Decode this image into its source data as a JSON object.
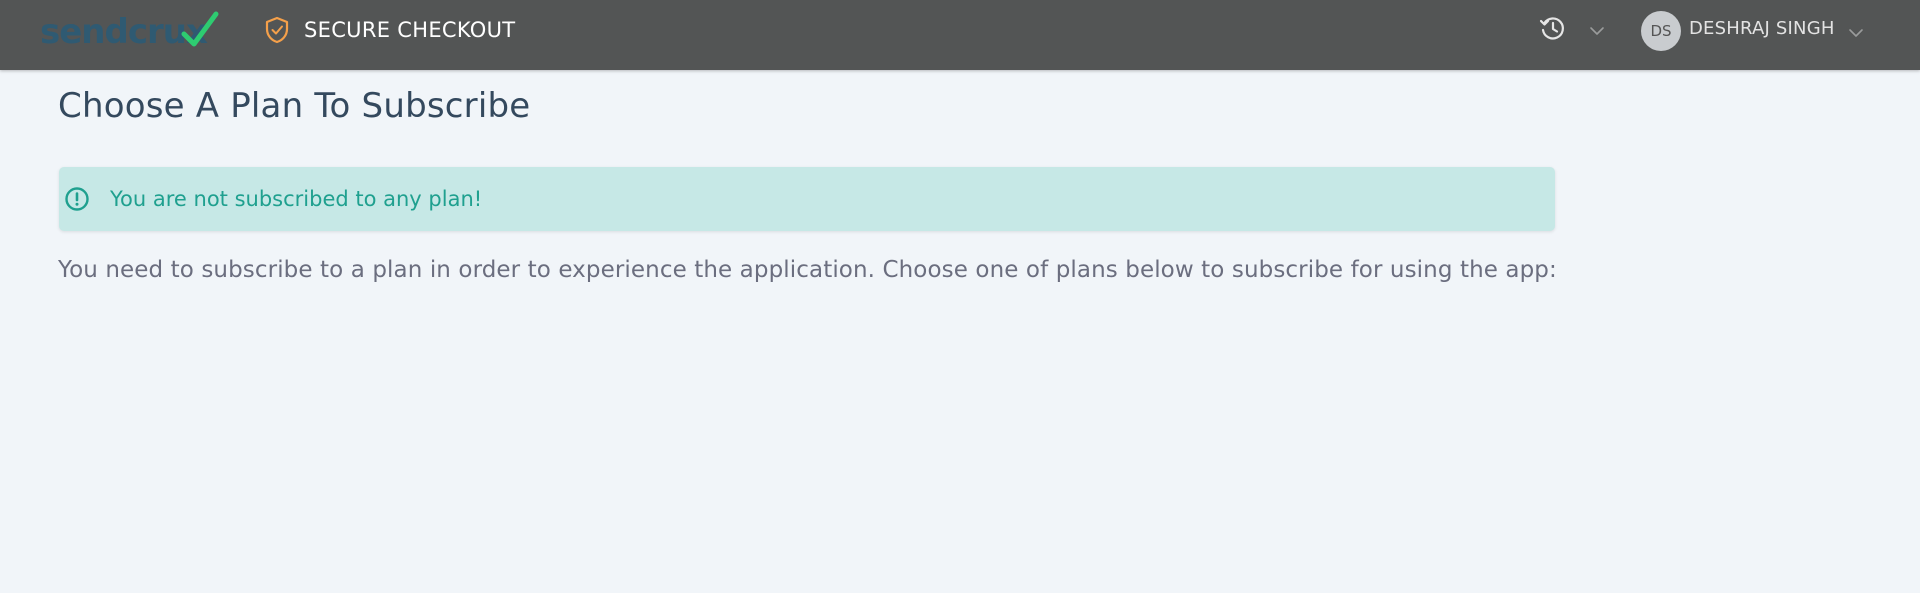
{
  "header": {
    "logo_text": "sendcrux",
    "secure_label": "SECURE CHECKOUT",
    "avatar_initials": "DS",
    "username": "DESHRAJ SINGH",
    "icons": {
      "secure": "shield-check-icon",
      "history": "history-icon",
      "history_dropdown": "chevron-down-icon",
      "user_dropdown": "chevron-down-icon"
    },
    "colors": {
      "bar": "#535555",
      "logo": "#2f5a72",
      "logo_check": "#2ecc71",
      "shield": "#f5a04a"
    }
  },
  "main": {
    "title": "Choose A Plan To Subscribe",
    "alert": {
      "icon": "exclamation-circle-icon",
      "text": "You are not subscribed to any plan!",
      "background": "#c6e8e6",
      "color": "#1fa08f"
    },
    "info_text": "You need to subscribe to a plan in order to experience the application. Choose one of plans below to subscribe for using the app:"
  }
}
